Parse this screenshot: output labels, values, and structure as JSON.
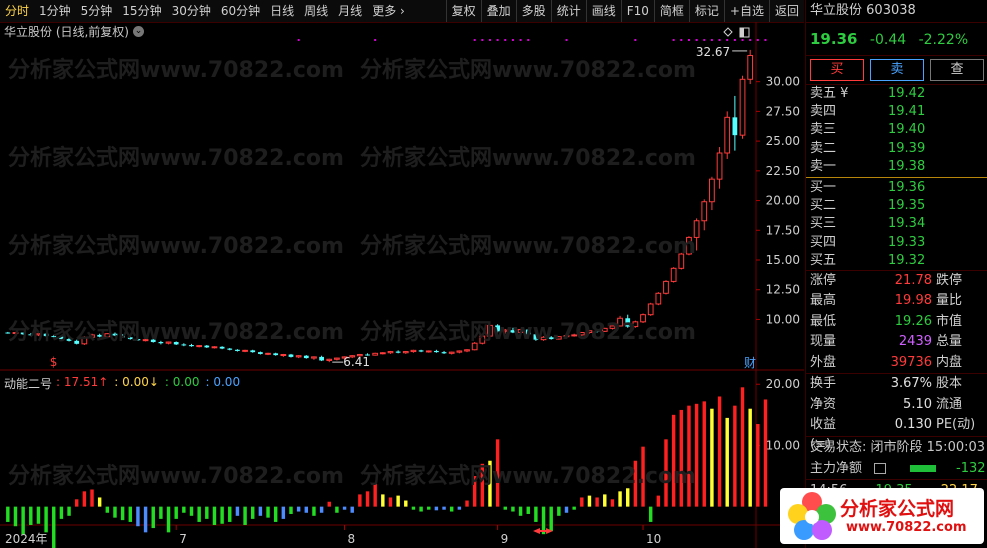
{
  "toolbar": {
    "periods": [
      "分时",
      "1分钟",
      "5分钟",
      "15分钟",
      "30分钟",
      "60分钟",
      "日线",
      "周线",
      "月线",
      "更多 ›"
    ],
    "active_index": 0,
    "tools": [
      "复权",
      "叠加",
      "多股",
      "统计",
      "画线",
      "F10",
      "简框",
      "标记",
      "+自选",
      "返回"
    ]
  },
  "chart_title": "华立股份 (日线,前复权)",
  "watermark": "分析家公式网www.70822.com",
  "indicator": {
    "name": "动能二号",
    "items": [
      {
        "text": ": 17.51↑",
        "color": "#ff3b3b"
      },
      {
        "text": ": 0.00↓",
        "color": "#ffd54a"
      },
      {
        "text": ": 0.00",
        "color": "#2ecc40"
      },
      {
        "text": ": 0.00",
        "color": "#4aa3ff"
      }
    ]
  },
  "chart_data": {
    "type": "candlestick",
    "price_axis": {
      "ticks": [
        "30.00",
        "27.50",
        "25.00",
        "22.50",
        "20.00",
        "17.50",
        "15.00",
        "12.50",
        "10.00"
      ],
      "range": [
        6.0,
        33.0
      ]
    },
    "indicator_axis": {
      "ticks": [
        "20.00",
        "10.00"
      ],
      "range": [
        -3,
        22
      ]
    },
    "x_labels": [
      "2024年",
      "7",
      "8",
      "9",
      "10"
    ],
    "annotations": {
      "high_label": "32.67",
      "low_label": "6.41",
      "event_marks": [
        "$",
        "财"
      ]
    },
    "candles": [
      [
        8.9,
        8.95,
        8.8,
        8.85
      ],
      [
        8.85,
        8.95,
        8.75,
        8.9
      ],
      [
        8.9,
        8.9,
        8.7,
        8.75
      ],
      [
        8.75,
        8.85,
        8.6,
        8.7
      ],
      [
        8.7,
        8.85,
        8.6,
        8.8
      ],
      [
        8.8,
        8.85,
        8.55,
        8.6
      ],
      [
        8.6,
        8.7,
        8.5,
        8.55
      ],
      [
        8.55,
        8.6,
        8.3,
        8.35
      ],
      [
        8.35,
        8.45,
        8.15,
        8.2
      ],
      [
        8.2,
        8.3,
        7.9,
        7.95
      ],
      [
        7.95,
        8.6,
        7.85,
        8.5
      ],
      [
        8.5,
        8.8,
        8.3,
        8.7
      ],
      [
        8.7,
        8.8,
        8.5,
        8.55
      ],
      [
        8.55,
        8.85,
        8.5,
        8.8
      ],
      [
        8.8,
        8.9,
        8.6,
        8.65
      ],
      [
        8.65,
        8.75,
        8.45,
        8.5
      ],
      [
        8.5,
        8.55,
        8.3,
        8.35
      ],
      [
        8.35,
        8.45,
        8.2,
        8.25
      ],
      [
        8.25,
        8.4,
        8.15,
        8.3
      ],
      [
        8.3,
        8.35,
        8.05,
        8.1
      ],
      [
        8.1,
        8.2,
        7.9,
        8.0
      ],
      [
        8.0,
        8.15,
        7.9,
        8.1
      ],
      [
        8.1,
        8.15,
        7.85,
        7.9
      ],
      [
        7.9,
        8.0,
        7.75,
        7.85
      ],
      [
        7.85,
        7.95,
        7.7,
        7.75
      ],
      [
        7.75,
        7.85,
        7.65,
        7.8
      ],
      [
        7.8,
        7.85,
        7.6,
        7.65
      ],
      [
        7.65,
        7.75,
        7.55,
        7.7
      ],
      [
        7.7,
        7.75,
        7.5,
        7.55
      ],
      [
        7.55,
        7.6,
        7.4,
        7.45
      ],
      [
        7.45,
        7.5,
        7.3,
        7.35
      ],
      [
        7.35,
        7.45,
        7.25,
        7.4
      ],
      [
        7.4,
        7.45,
        7.2,
        7.25
      ],
      [
        7.25,
        7.3,
        7.05,
        7.1
      ],
      [
        7.1,
        7.2,
        7.0,
        7.15
      ],
      [
        7.15,
        7.2,
        6.95,
        7.0
      ],
      [
        7.0,
        7.1,
        6.85,
        7.05
      ],
      [
        7.05,
        7.1,
        6.8,
        6.85
      ],
      [
        6.85,
        7.0,
        6.75,
        6.95
      ],
      [
        6.95,
        7.0,
        6.7,
        6.75
      ],
      [
        6.75,
        6.9,
        6.6,
        6.85
      ],
      [
        6.85,
        6.95,
        6.5,
        6.55
      ],
      [
        6.55,
        6.7,
        6.41,
        6.65
      ],
      [
        6.65,
        6.8,
        6.55,
        6.75
      ],
      [
        6.75,
        6.9,
        6.6,
        6.85
      ],
      [
        6.85,
        7.0,
        6.75,
        6.95
      ],
      [
        6.95,
        7.1,
        6.85,
        7.05
      ],
      [
        7.05,
        7.15,
        6.95,
        7.0
      ],
      [
        7.0,
        7.2,
        6.95,
        7.15
      ],
      [
        7.15,
        7.25,
        7.05,
        7.2
      ],
      [
        7.2,
        7.35,
        7.1,
        7.3
      ],
      [
        7.3,
        7.4,
        7.15,
        7.2
      ],
      [
        7.2,
        7.35,
        7.1,
        7.3
      ],
      [
        7.3,
        7.45,
        7.2,
        7.4
      ],
      [
        7.4,
        7.45,
        7.25,
        7.3
      ],
      [
        7.3,
        7.4,
        7.2,
        7.35
      ],
      [
        7.35,
        7.45,
        7.2,
        7.25
      ],
      [
        7.25,
        7.35,
        7.1,
        7.15
      ],
      [
        7.15,
        7.3,
        7.05,
        7.25
      ],
      [
        7.25,
        7.4,
        7.15,
        7.35
      ],
      [
        7.35,
        7.5,
        7.25,
        7.45
      ],
      [
        7.45,
        8.1,
        7.4,
        8.0
      ],
      [
        8.0,
        8.8,
        7.9,
        8.6
      ],
      [
        8.6,
        9.7,
        8.5,
        9.5
      ],
      [
        9.5,
        9.6,
        8.9,
        9.0
      ],
      [
        9.0,
        9.2,
        8.8,
        9.1
      ],
      [
        9.1,
        9.3,
        8.85,
        8.9
      ],
      [
        8.9,
        9.2,
        8.8,
        9.15
      ],
      [
        9.15,
        9.2,
        8.7,
        8.75
      ],
      [
        8.75,
        8.85,
        8.2,
        8.3
      ],
      [
        8.3,
        8.6,
        8.2,
        8.5
      ],
      [
        8.5,
        8.6,
        8.3,
        8.35
      ],
      [
        8.35,
        8.6,
        8.3,
        8.55
      ],
      [
        8.55,
        8.7,
        8.4,
        8.65
      ],
      [
        8.65,
        8.8,
        8.55,
        8.7
      ],
      [
        8.7,
        8.95,
        8.6,
        8.9
      ],
      [
        8.9,
        9.1,
        8.8,
        9.05
      ],
      [
        9.05,
        9.2,
        8.9,
        9.0
      ],
      [
        9.0,
        9.3,
        8.95,
        9.25
      ],
      [
        9.25,
        9.5,
        9.15,
        9.45
      ],
      [
        9.45,
        10.3,
        9.4,
        10.1
      ],
      [
        10.1,
        10.4,
        9.3,
        9.4
      ],
      [
        9.4,
        9.9,
        9.3,
        9.8
      ],
      [
        9.8,
        10.5,
        9.7,
        10.4
      ],
      [
        10.4,
        11.4,
        10.3,
        11.3
      ],
      [
        11.3,
        12.3,
        11.2,
        12.2
      ],
      [
        12.2,
        13.3,
        12.1,
        13.2
      ],
      [
        13.2,
        14.4,
        13.1,
        14.3
      ],
      [
        14.3,
        15.6,
        14.2,
        15.5
      ],
      [
        15.5,
        17.0,
        15.4,
        16.9
      ],
      [
        16.9,
        18.5,
        15.8,
        18.3
      ],
      [
        18.3,
        20.1,
        17.5,
        19.9
      ],
      [
        19.9,
        22.0,
        19.2,
        21.8
      ],
      [
        21.8,
        24.5,
        21.0,
        24.0
      ],
      [
        24.0,
        27.5,
        23.5,
        27.0
      ],
      [
        27.0,
        28.8,
        24.2,
        25.5
      ],
      [
        25.5,
        30.5,
        25.2,
        30.2
      ],
      [
        30.2,
        32.67,
        29.8,
        32.2
      ]
    ],
    "momentum": [
      -2.5,
      -3.2,
      -4.5,
      -3.0,
      -2.8,
      -4.2,
      -7.0,
      -2.0,
      -1.5,
      1.2,
      2.5,
      2.8,
      1.5,
      -1.0,
      -1.8,
      -2.2,
      -2.5,
      -3.2,
      -4.2,
      -3.5,
      -2.0,
      -4.2,
      -2.0,
      -1.0,
      -1.5,
      -2.5,
      -2.0,
      -3.0,
      -2.8,
      -2.5,
      -1.5,
      -3.0,
      -2.0,
      -1.5,
      -1.8,
      -2.5,
      -2.0,
      -1.2,
      -0.8,
      -1.0,
      -1.5,
      -1.0,
      0.8,
      -1.0,
      -0.5,
      -1.0,
      2.0,
      2.5,
      3.8,
      2.0,
      1.5,
      1.8,
      1.0,
      -0.5,
      -0.8,
      -0.5,
      -0.6,
      -0.5,
      -0.8,
      -0.5,
      1.0,
      5.0,
      7.0,
      7.5,
      11.0,
      -0.5,
      -0.8,
      -1.5,
      -1.2,
      -2.5,
      -4.5,
      -4.0,
      -1.5,
      -1.0,
      -0.5,
      1.5,
      1.8,
      1.5,
      2.0,
      1.2,
      2.5,
      3.0,
      7.5,
      9.8,
      -2.5,
      1.8,
      11.0,
      15.0,
      15.8,
      16.5,
      16.8,
      17.2,
      16.0,
      18.0,
      14.5,
      16.5,
      19.5,
      16.0,
      13.5,
      17.51
    ],
    "momentum_colors": [
      "g",
      "g",
      "g",
      "g",
      "g",
      "g",
      "g",
      "g",
      "g",
      "r",
      "r",
      "r",
      "y",
      "g",
      "g",
      "g",
      "g",
      "b",
      "b",
      "g",
      "g",
      "g",
      "g",
      "g",
      "g",
      "g",
      "g",
      "g",
      "g",
      "g",
      "b",
      "g",
      "g",
      "b",
      "g",
      "g",
      "b",
      "g",
      "b",
      "b",
      "g",
      "b",
      "r",
      "g",
      "b",
      "b",
      "r",
      "r",
      "r",
      "y",
      "r",
      "y",
      "y",
      "g",
      "g",
      "g",
      "b",
      "b",
      "g",
      "b",
      "r",
      "r",
      "r",
      "y",
      "r",
      "g",
      "g",
      "g",
      "g",
      "g",
      "g",
      "g",
      "g",
      "b",
      "g",
      "r",
      "y",
      "r",
      "y",
      "r",
      "y",
      "y",
      "r",
      "r",
      "g",
      "r",
      "r",
      "r",
      "r",
      "r",
      "r",
      "r",
      "y",
      "r",
      "y",
      "r",
      "r",
      "y",
      "r",
      "r"
    ]
  },
  "quote": {
    "name": "华立股份",
    "code": "603038",
    "price": "19.36",
    "change": "-0.44",
    "change_pct": "-2.22%",
    "buttons": [
      "买",
      "卖",
      "查"
    ],
    "sells": [
      {
        "label": "卖五 ¥",
        "price": "19.42"
      },
      {
        "label": "卖四",
        "price": "19.41"
      },
      {
        "label": "卖三",
        "price": "19.40"
      },
      {
        "label": "卖二",
        "price": "19.39"
      },
      {
        "label": "卖一",
        "price": "19.38"
      }
    ],
    "buys": [
      {
        "label": "买一",
        "price": "19.36"
      },
      {
        "label": "买二",
        "price": "19.35"
      },
      {
        "label": "买三",
        "price": "19.34"
      },
      {
        "label": "买四",
        "price": "19.33"
      },
      {
        "label": "买五",
        "price": "19.32"
      }
    ],
    "stats": [
      {
        "label": "涨停",
        "value": "21.78",
        "color": "red",
        "label2": "跌停"
      },
      {
        "label": "最高",
        "value": "19.98",
        "color": "red",
        "label2": "量比"
      },
      {
        "label": "最低",
        "value": "19.26",
        "color": "grn",
        "label2": "市值"
      },
      {
        "label": "现量",
        "value": "2439",
        "color": "pur",
        "label2": "总量"
      },
      {
        "label": "外盘",
        "value": "39736",
        "color": "red",
        "label2": "内盘"
      }
    ],
    "fin": [
      {
        "label": "换手",
        "value": "3.67%",
        "label2": "股本"
      },
      {
        "label": "净资",
        "value": "5.10",
        "label2": "流通"
      },
      {
        "label": "收益(≡)",
        "value": "0.130",
        "label2": "PE(动)"
      }
    ],
    "trade_status": "交易状态: 闭市阶段 15:00:03",
    "net_inflow_label": "主力净额",
    "net_inflow_value": "-132",
    "last_time": "14:56",
    "last_price": "19.35",
    "last_vol": "22.17"
  },
  "logo": {
    "name": "分析家公式网",
    "url": "www.70822.com"
  }
}
